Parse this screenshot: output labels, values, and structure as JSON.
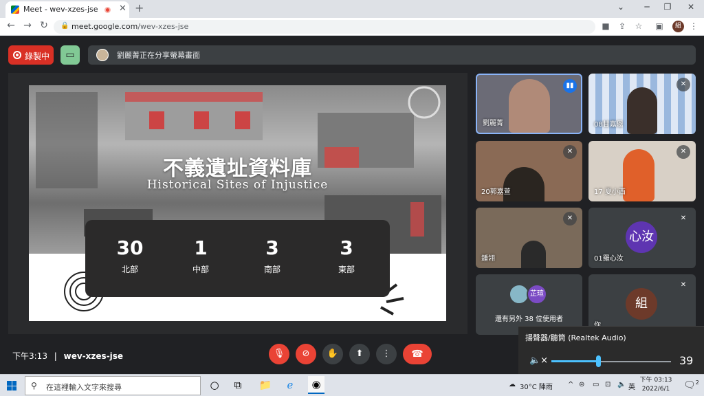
{
  "browser": {
    "tab_title": "Meet - wev-xzes-jse",
    "tab_close": "✕",
    "new_tab": "+",
    "window_controls": [
      "⌄",
      "─",
      "❐",
      "✕"
    ],
    "url_host": "meet.google.com",
    "url_path": "/wev-xzes-jse",
    "profile_initial": "組"
  },
  "meet": {
    "record_label": "錄製中",
    "presenting_text": "劉麗菁正在分享螢幕畫面",
    "meeting_time": "下午3:13",
    "meeting_code": "wev-xzes-jse",
    "separator": "|"
  },
  "slide": {
    "title": "不義遺址資料庫",
    "subtitle": "Historical Sites of Injustice",
    "stats": [
      {
        "num": "30",
        "label": "北部"
      },
      {
        "num": "1",
        "label": "中部"
      },
      {
        "num": "3",
        "label": "南部"
      },
      {
        "num": "3",
        "label": "東部"
      }
    ]
  },
  "participants": [
    {
      "name": "劉麗菁",
      "speaking": true
    },
    {
      "name": "08甘嘉恩"
    },
    {
      "name": "20郭嘉萱"
    },
    {
      "name": "17 夏小西"
    },
    {
      "name": "鍾翎"
    },
    {
      "name": "01羅心汝",
      "initial": "心汝"
    },
    {
      "name": "還有另外 38 位使用者",
      "initial": "芷瑄"
    },
    {
      "name": "你",
      "initial": "組"
    }
  ],
  "volume": {
    "device": "揚聲器/聽筒 (Realtek Audio)",
    "level": 39,
    "level_text": "39"
  },
  "taskbar": {
    "search_placeholder": "在這裡輸入文字來搜尋",
    "weather": "30°C 陣雨",
    "ime": "英",
    "time": "下午 03:13",
    "date": "2022/6/1",
    "notification_count": "2"
  },
  "colors": {
    "record_red": "#d93025",
    "hangup_red": "#ea4335",
    "active_border": "#8ab4f8",
    "volume_accent": "#4cc2ff"
  }
}
